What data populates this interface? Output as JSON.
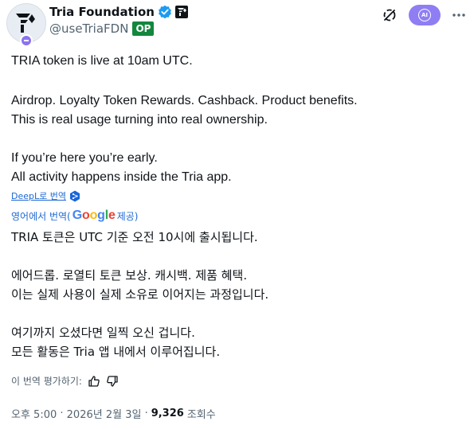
{
  "author": {
    "display_name": "Tria Foundation",
    "handle": "@useTriaFDN",
    "op_badge": "OP",
    "avatar_icon": "tria-logo-icon",
    "verified_color": "#1d9bf0"
  },
  "actions": {
    "mute_icon": "no-signal-icon",
    "grok_label": "AI",
    "more_icon": "more-icon"
  },
  "tweet": {
    "lines": [
      "TRIA token is live at 10am UTC.",
      "Airdrop. Loyalty Token Rewards. Cashback. Product benefits.",
      "This is real usage turning into real ownership.",
      "If you’re here you’re early.",
      "All activity happens inside the Tria app."
    ]
  },
  "translation": {
    "deepl_link": "DeepL로 번역",
    "google_prefix": "영어에서 번역(",
    "google_word": "Google",
    "google_suffix": " 제공)",
    "lines": [
      "TRIA 토큰은 UTC 기준 오전 10시에 출시됩니다.",
      "에어드롭. 로열티 토큰 보상. 캐시백. 제품 혜택.",
      "이는 실제 사용이 실제 소유로 이어지는 과정입니다.",
      "여기까지 오셨다면 일찍 오신 겁니다.",
      "모든 활동은 Tria 앱 내에서 이루어집니다."
    ],
    "rate_label": "이 번역 평가하기:"
  },
  "meta": {
    "time": "오후 5:00",
    "date": "2026년 2월 3일",
    "views_count": "9,326",
    "views_label": "조회수"
  },
  "colors": {
    "accent": "#1d9bf0",
    "grok": "#8f7df4",
    "op": "#13873d",
    "link": "#1d68d4"
  }
}
